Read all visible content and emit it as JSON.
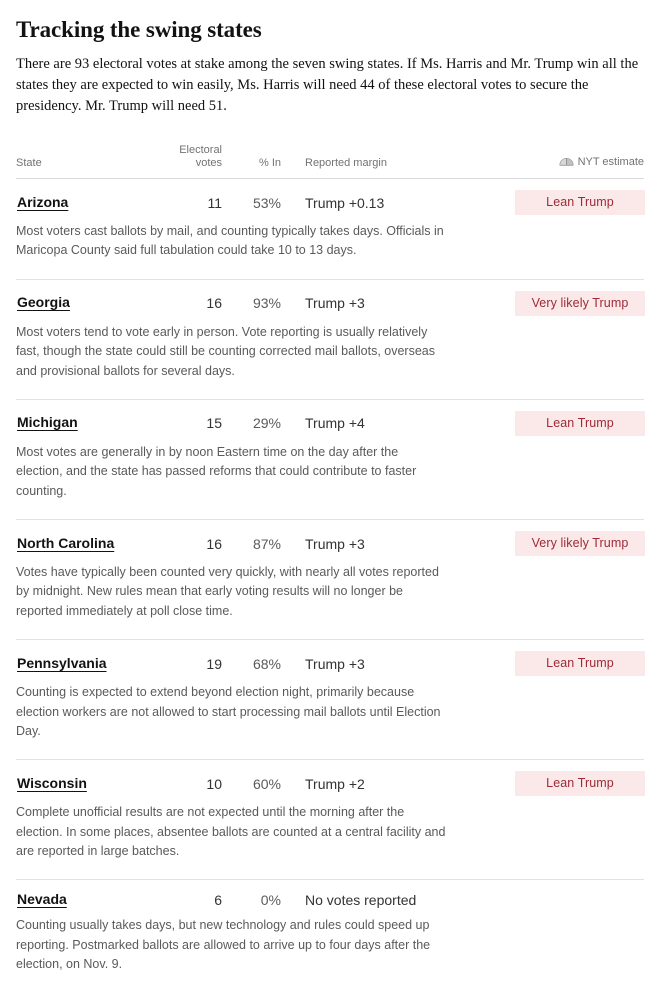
{
  "article": {
    "headline": "Tracking the swing states",
    "standfirst": "There are 93 electoral votes at stake among the seven swing states. If Ms. Harris and Mr. Trump win all the states they are expected to win easily, Ms. Harris will need 44 of these electoral votes to secure the presidency. Mr. Trump will need 51."
  },
  "table": {
    "columns": {
      "state": "State",
      "electoral_votes_line1": "Electoral",
      "electoral_votes_line2": "votes",
      "percent_in": "% In",
      "reported_margin": "Reported margin",
      "nyt_estimate": "NYT estimate",
      "nyt_estimate_icon": "dome-needle-icon"
    },
    "rows": [
      {
        "state": "Arizona",
        "electoral_votes": "11",
        "percent_in": "53%",
        "reported_margin": "Trump +0.13",
        "estimate": "Lean Trump",
        "note": "Most voters cast ballots by mail, and counting typically takes days. Officials in Maricopa County said full tabulation could take 10 to 13 days."
      },
      {
        "state": "Georgia",
        "electoral_votes": "16",
        "percent_in": "93%",
        "reported_margin": "Trump +3",
        "estimate": "Very likely Trump",
        "note": "Most voters tend to vote early in person. Vote reporting is usually relatively fast, though the state could still be counting corrected mail ballots, overseas and provisional ballots for several days."
      },
      {
        "state": "Michigan",
        "electoral_votes": "15",
        "percent_in": "29%",
        "reported_margin": "Trump +4",
        "estimate": "Lean Trump",
        "note": "Most votes are generally in by noon Eastern time on the day after the election, and the state has passed reforms that could contribute to faster counting."
      },
      {
        "state": "North Carolina",
        "electoral_votes": "16",
        "percent_in": "87%",
        "reported_margin": "Trump +3",
        "estimate": "Very likely Trump",
        "note": "Votes have typically been counted very quickly, with nearly all votes reported by midnight. New rules mean that early voting results will no longer be reported immediately at poll close time."
      },
      {
        "state": "Pennsylvania",
        "electoral_votes": "19",
        "percent_in": "68%",
        "reported_margin": "Trump +3",
        "estimate": "Lean Trump",
        "note": "Counting is expected to extend beyond election night, primarily because election workers are not allowed to start processing mail ballots until Election Day."
      },
      {
        "state": "Wisconsin",
        "electoral_votes": "10",
        "percent_in": "60%",
        "reported_margin": "Trump +2",
        "estimate": "Lean Trump",
        "note": "Complete unofficial results are not expected until the morning after the election. In some places, absentee ballots are counted at a central facility and are reported in large batches."
      },
      {
        "state": "Nevada",
        "electoral_votes": "6",
        "percent_in": "0%",
        "reported_margin": "No votes reported",
        "estimate": "",
        "note": "Counting usually takes days, but new technology and rules could speed up reporting. Postmarked ballots are allowed to arrive up to four days after the election, on Nov. 9."
      }
    ]
  },
  "colors": {
    "badge_background": "#fbe9ea",
    "badge_text": "#9e2a36",
    "rule": "#e2e2e2",
    "body_text": "#121212",
    "muted_text": "#5a5a5a"
  }
}
